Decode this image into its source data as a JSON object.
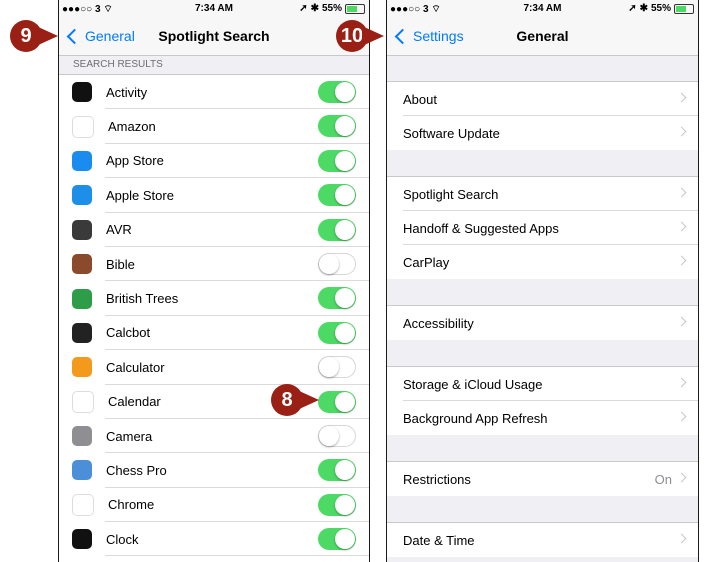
{
  "left": {
    "status": {
      "carrier": "●●●○○ 3 ⌔",
      "time": "7:34 AM",
      "battery": "55%"
    },
    "nav": {
      "back": "General",
      "title": "Spotlight Search"
    },
    "section_header": "SEARCH RESULTS",
    "items": [
      {
        "label": "Activity",
        "on": true,
        "icon_bg": "#111111",
        "icon": "activity-rings-icon"
      },
      {
        "label": "Amazon",
        "on": true,
        "icon_bg": "#ffffff",
        "icon": "amazon-icon"
      },
      {
        "label": "App Store",
        "on": true,
        "icon_bg": "#1a8cf0",
        "icon": "app-store-icon"
      },
      {
        "label": "Apple Store",
        "on": true,
        "icon_bg": "#1e8fe8",
        "icon": "apple-store-icon"
      },
      {
        "label": "AVR",
        "on": true,
        "icon_bg": "#3a3a3a",
        "icon": "microphone-icon"
      },
      {
        "label": "Bible",
        "on": false,
        "icon_bg": "#8b4a2c",
        "icon": "bible-icon"
      },
      {
        "label": "British Trees",
        "on": true,
        "icon_bg": "#2e9d4a",
        "icon": "leaf-icon"
      },
      {
        "label": "Calcbot",
        "on": true,
        "icon_bg": "#222222",
        "icon": "calcbot-icon"
      },
      {
        "label": "Calculator",
        "on": false,
        "icon_bg": "#f39a1c",
        "icon": "calculator-icon"
      },
      {
        "label": "Calendar",
        "on": true,
        "icon_bg": "#ffffff",
        "icon": "calendar-icon"
      },
      {
        "label": "Camera",
        "on": false,
        "icon_bg": "#8e8e93",
        "icon": "camera-icon"
      },
      {
        "label": "Chess Pro",
        "on": true,
        "icon_bg": "#4a8fd8",
        "icon": "chess-knight-icon"
      },
      {
        "label": "Chrome",
        "on": true,
        "icon_bg": "#ffffff",
        "icon": "chrome-icon"
      },
      {
        "label": "Clock",
        "on": true,
        "icon_bg": "#111111",
        "icon": "clock-icon"
      }
    ]
  },
  "right": {
    "status": {
      "carrier": "●●●○○ 3 ⌔",
      "time": "7:34 AM",
      "battery": "55%"
    },
    "nav": {
      "back": "Settings",
      "title": "General"
    },
    "groups": [
      [
        {
          "label": "About"
        },
        {
          "label": "Software Update"
        }
      ],
      [
        {
          "label": "Spotlight Search"
        },
        {
          "label": "Handoff & Suggested Apps"
        },
        {
          "label": "CarPlay"
        }
      ],
      [
        {
          "label": "Accessibility"
        }
      ],
      [
        {
          "label": "Storage & iCloud Usage"
        },
        {
          "label": "Background App Refresh"
        }
      ],
      [
        {
          "label": "Restrictions",
          "detail": "On"
        }
      ],
      [
        {
          "label": "Date & Time"
        }
      ]
    ]
  },
  "callouts": {
    "step8": "8",
    "step9": "9",
    "step10": "10"
  },
  "colors": {
    "toggle_on": "#4cd964",
    "link": "#007aff",
    "callout": "#9a1f14"
  }
}
